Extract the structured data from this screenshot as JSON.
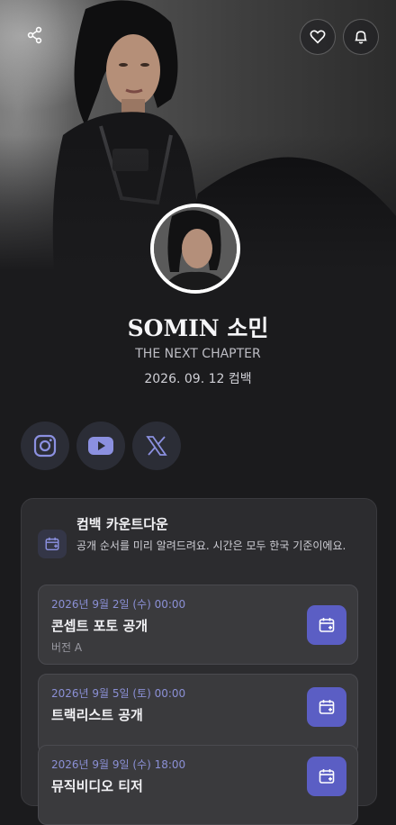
{
  "header": {
    "share_icon": "share-icon",
    "like_icon": "heart-icon",
    "notify_icon": "bell-icon"
  },
  "artist": {
    "name": "SOMIN 소민",
    "subtitle": "THE NEXT CHAPTER",
    "comeback_date": "2026. 09. 12 컴백"
  },
  "social": [
    {
      "icon": "instagram-icon"
    },
    {
      "icon": "youtube-icon"
    },
    {
      "icon": "x-icon"
    }
  ],
  "countdown": {
    "title": "컴백 카운트다운",
    "description": "공개 순서를 미리 알려드려요. 시간은 모두 한국 기준이에요.",
    "events": [
      {
        "date": "2026년 9월 2일 (수) 00:00",
        "title": "콘셉트 포토 공개",
        "note": "버전 A"
      },
      {
        "date": "2026년 9월 5일 (토) 00:00",
        "title": "트랙리스트 공개",
        "note": ""
      },
      {
        "date": "2026년 9월 9일 (수) 18:00",
        "title": "뮤직비디오 티저",
        "note": ""
      }
    ]
  },
  "colors": {
    "accent": "#5b5ec4",
    "date_text": "#8b90d6",
    "background": "#1b1b1d"
  }
}
